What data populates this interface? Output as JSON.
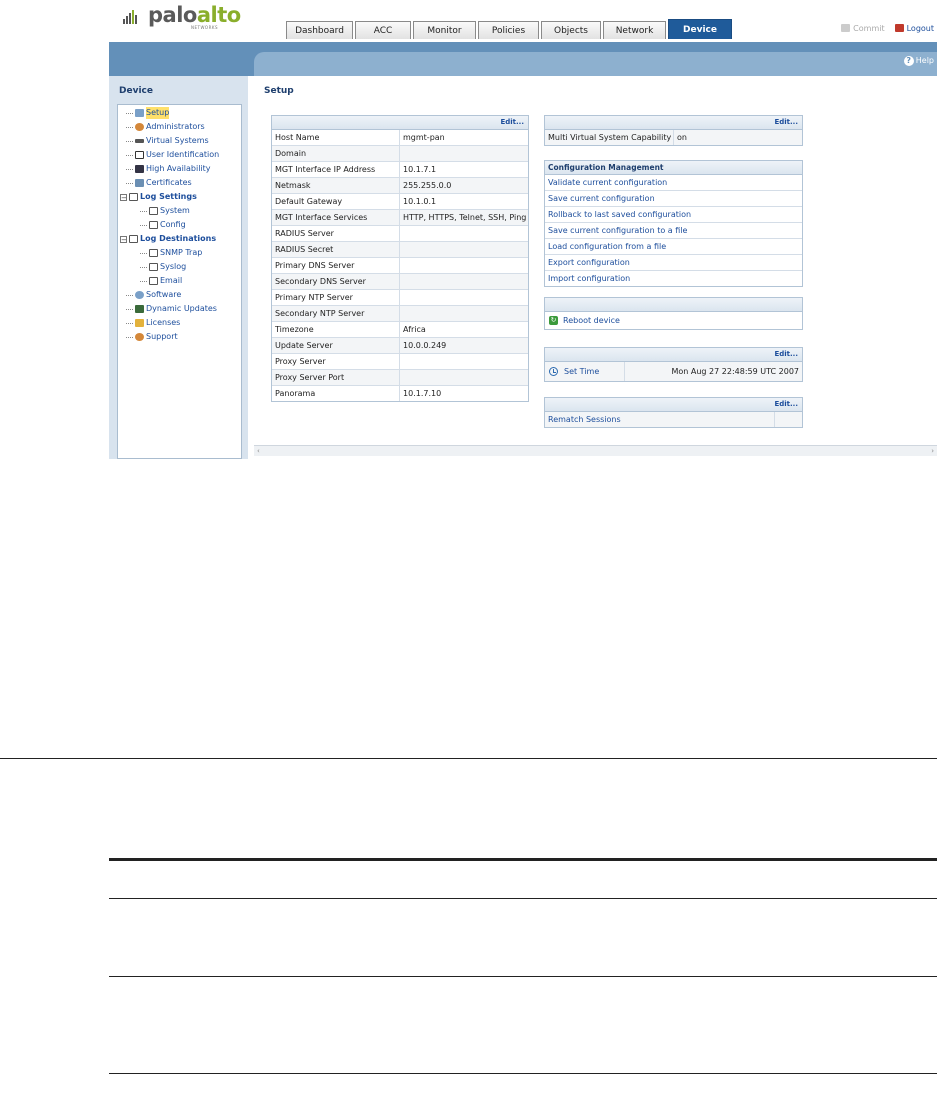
{
  "brand": {
    "name_part1": "palo",
    "name_part2": "alto",
    "sub": "NETWORKS"
  },
  "tabs": [
    "Dashboard",
    "ACC",
    "Monitor",
    "Policies",
    "Objects",
    "Network",
    "Device"
  ],
  "active_tab": "Device",
  "toplinks": {
    "commit": "Commit",
    "logout": "Logout"
  },
  "help": "Help",
  "left_panel": {
    "title": "Device",
    "items": [
      {
        "label": "Setup",
        "icon": "setup-icon"
      },
      {
        "label": "Administrators",
        "icon": "admin-icon"
      },
      {
        "label": "Virtual Systems",
        "icon": "vsys-icon"
      },
      {
        "label": "User Identification",
        "icon": "userid-icon"
      },
      {
        "label": "High Availability",
        "icon": "ha-icon"
      },
      {
        "label": "Certificates",
        "icon": "certificate-icon"
      },
      {
        "label": "Log Settings",
        "icon": "folder-icon"
      },
      {
        "label": "System",
        "icon": "document-icon"
      },
      {
        "label": "Config",
        "icon": "document-icon"
      },
      {
        "label": "Log Destinations",
        "icon": "folder-icon"
      },
      {
        "label": "SNMP Trap",
        "icon": "document-icon"
      },
      {
        "label": "Syslog",
        "icon": "document-icon"
      },
      {
        "label": "Email",
        "icon": "document-icon"
      },
      {
        "label": "Software",
        "icon": "software-icon"
      },
      {
        "label": "Dynamic Updates",
        "icon": "updates-icon"
      },
      {
        "label": "Licenses",
        "icon": "key-icon"
      },
      {
        "label": "Support",
        "icon": "support-icon"
      }
    ]
  },
  "content": {
    "title": "Setup",
    "edit_label": "Edit...",
    "mgmt": [
      {
        "key": "Host Name",
        "value": "mgmt-pan"
      },
      {
        "key": "Domain",
        "value": ""
      },
      {
        "key": "MGT Interface IP Address",
        "value": "10.1.7.1"
      },
      {
        "key": "Netmask",
        "value": "255.255.0.0"
      },
      {
        "key": "Default Gateway",
        "value": "10.1.0.1"
      },
      {
        "key": "MGT Interface Services",
        "value": "HTTP, HTTPS, Telnet, SSH, Ping"
      },
      {
        "key": "RADIUS Server",
        "value": ""
      },
      {
        "key": "RADIUS Secret",
        "value": ""
      },
      {
        "key": "Primary DNS Server",
        "value": ""
      },
      {
        "key": "Secondary DNS Server",
        "value": ""
      },
      {
        "key": "Primary NTP Server",
        "value": ""
      },
      {
        "key": "Secondary NTP Server",
        "value": ""
      },
      {
        "key": "Timezone",
        "value": "Africa"
      },
      {
        "key": "Update Server",
        "value": "10.0.0.249"
      },
      {
        "key": "Proxy Server",
        "value": ""
      },
      {
        "key": "Proxy Server Port",
        "value": ""
      },
      {
        "key": "Panorama",
        "value": "10.1.7.10"
      }
    ],
    "multi_vsys": {
      "key": "Multi Virtual System Capability",
      "value": "on"
    },
    "config_mgmt": {
      "title": "Configuration Management",
      "links": [
        "Validate current configuration",
        "Save current configuration",
        "Rollback to last saved configuration",
        "Save current configuration to a file",
        "Load configuration from a file",
        "Export configuration",
        "Import configuration"
      ]
    },
    "reboot": "Reboot device",
    "set_time": {
      "label": "Set Time",
      "value": "Mon Aug 27 22:48:59 UTC 2007"
    },
    "rematch": {
      "label": "Rematch Sessions",
      "value": ""
    }
  }
}
